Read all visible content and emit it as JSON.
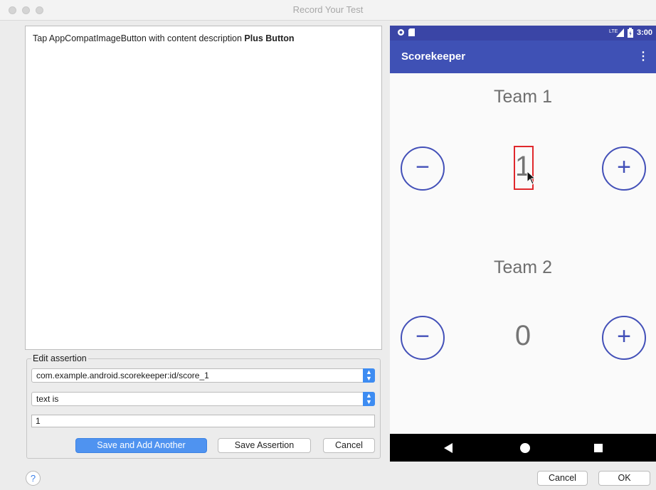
{
  "window": {
    "title": "Record Your Test"
  },
  "log": {
    "prefix": "Tap AppCompatImageButton with content description ",
    "bold": "Plus Button"
  },
  "assertion": {
    "legend": "Edit assertion",
    "view_id": "com.example.android.scorekeeper:id/score_1",
    "condition": "text is",
    "value": "1",
    "save_add_label": "Save and Add Another",
    "save_label": "Save Assertion",
    "cancel_label": "Cancel"
  },
  "device": {
    "status_time": "3:00",
    "network": "LTE",
    "app_title": "Scorekeeper",
    "team1_label": "Team 1",
    "team1_score": "1",
    "team2_label": "Team 2",
    "team2_score": "0",
    "minus_symbol": "−",
    "plus_symbol": "+"
  },
  "dialog": {
    "help": "?",
    "cancel_label": "Cancel",
    "ok_label": "OK"
  },
  "colors": {
    "primary": "#3f51b5",
    "status_bar": "#3a45a6",
    "button_blue": "#4f93f0",
    "highlight": "#e0282c"
  }
}
